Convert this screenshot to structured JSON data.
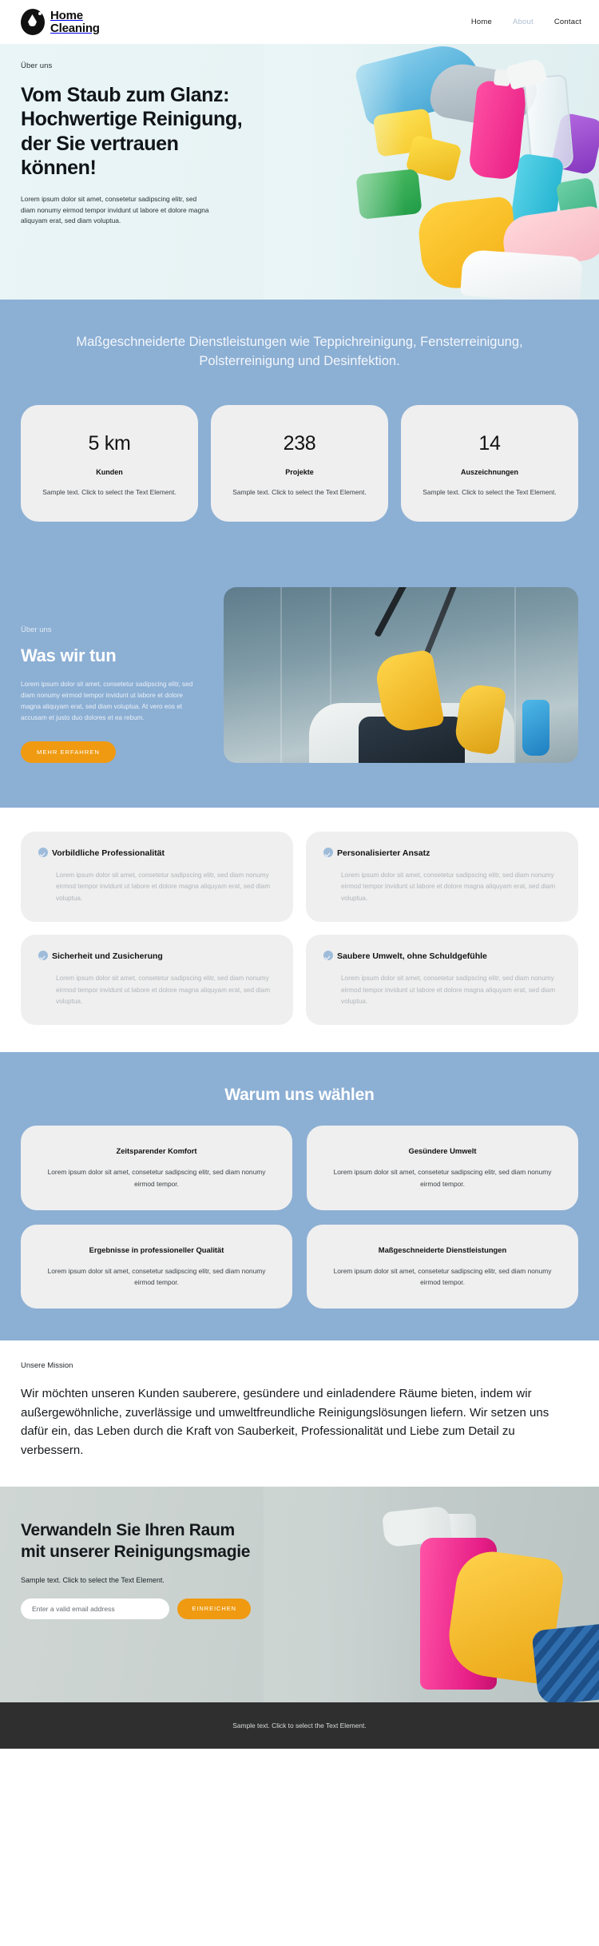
{
  "header": {
    "brand_line1": "Home",
    "brand_line2": "Cleaning",
    "nav": [
      {
        "label": "Home"
      },
      {
        "label": "About"
      },
      {
        "label": "Contact"
      }
    ]
  },
  "hero": {
    "eyebrow": "Über uns",
    "title": "Vom Staub zum Glanz: Hochwertige Reinigung, der Sie vertrauen können!",
    "copy": "Lorem ipsum dolor sit amet, consetetur sadipscing elitr, sed diam nonumy eirmod tempor invidunt ut labore et dolore magna aliquyam erat, sed diam voluptua."
  },
  "services": {
    "text": "Maßgeschneiderte Dienstleistungen wie Teppichreinigung, Fensterreinigung, Polsterreinigung und Desinfektion.",
    "stats": [
      {
        "value": "5 km",
        "label": "Kunden",
        "desc": "Sample text. Click to select the Text Element."
      },
      {
        "value": "238",
        "label": "Projekte",
        "desc": "Sample text. Click to select the Text Element."
      },
      {
        "value": "14",
        "label": "Auszeichnungen",
        "desc": "Sample text. Click to select the Text Element."
      }
    ]
  },
  "about": {
    "eyebrow": "Über uns",
    "title": "Was wir tun",
    "copy": "Lorem ipsum dolor sit amet, consetetur sadipscing elitr, sed diam nonumy eirmod tempor invidunt ut labore et dolore magna aliquyam erat, sed diam voluptua. At vero eos et accusam et justo duo dolores et ea rebum.",
    "button_label": "MEHR ERFAHREN"
  },
  "features": [
    {
      "title": "Vorbildliche Professionalität",
      "copy": "Lorem ipsum dolor sit amet, consetetur sadipscing elitr, sed diam nonumy eirmod tempor invidunt ut labore et dolore magna aliquyam erat, sed diam voluptua."
    },
    {
      "title": "Personalisierter Ansatz",
      "copy": "Lorem ipsum dolor sit amet, consetetur sadipscing elitr, sed diam nonumy eirmod tempor invidunt ut labore et dolore magna aliquyam erat, sed diam voluptua."
    },
    {
      "title": "Sicherheit und Zusicherung",
      "copy": "Lorem ipsum dolor sit amet, consetetur sadipscing elitr, sed diam nonumy eirmod tempor invidunt ut labore et dolore magna aliquyam erat, sed diam voluptua."
    },
    {
      "title": "Saubere Umwelt, ohne Schuldgefühle",
      "copy": "Lorem ipsum dolor sit amet, consetetur sadipscing elitr, sed diam nonumy eirmod tempor invidunt ut labore et dolore magna aliquyam erat, sed diam voluptua."
    }
  ],
  "why": {
    "title": "Warum uns wählen",
    "cards": [
      {
        "title": "Zeitsparender Komfort",
        "copy": "Lorem ipsum dolor sit amet, consetetur sadipscing elitr, sed diam nonumy eirmod tempor."
      },
      {
        "title": "Gesündere Umwelt",
        "copy": "Lorem ipsum dolor sit amet, consetetur sadipscing elitr, sed diam nonumy eirmod tempor."
      },
      {
        "title": "Ergebnisse in professioneller Qualität",
        "copy": "Lorem ipsum dolor sit amet, consetetur sadipscing elitr, sed diam nonumy eirmod tempor."
      },
      {
        "title": "Maßgeschneiderte Dienstleistungen",
        "copy": "Lorem ipsum dolor sit amet, consetetur sadipscing elitr, sed diam nonumy eirmod tempor."
      }
    ]
  },
  "mission": {
    "eyebrow": "Unsere Mission",
    "text": "Wir möchten unseren Kunden sauberere, gesündere und einladendere Räume bieten, indem wir außergewöhnliche, zuverlässige und umweltfreundliche Reinigungslösungen liefern. Wir setzen uns dafür ein, das Leben durch die Kraft von Sauberkeit, Professionalität und Liebe zum Detail zu verbessern."
  },
  "cta": {
    "title": "Verwandeln Sie Ihren Raum mit unserer Reinigungsmagie",
    "sub": "Sample text. Click to select the Text Element.",
    "email_placeholder": "Enter a valid email address",
    "email_value": "",
    "submit_label": "EINREICHEN"
  },
  "footer": {
    "text": "Sample text. Click to select the Text Element."
  },
  "colors": {
    "brand_blue": "#8cafd4",
    "accent_orange": "#ef9a11",
    "card_grey": "#efefef",
    "footer_dark": "#2f2f2f",
    "hero_tint": "#e9f5f6",
    "check_blue": "#9ebcda"
  }
}
